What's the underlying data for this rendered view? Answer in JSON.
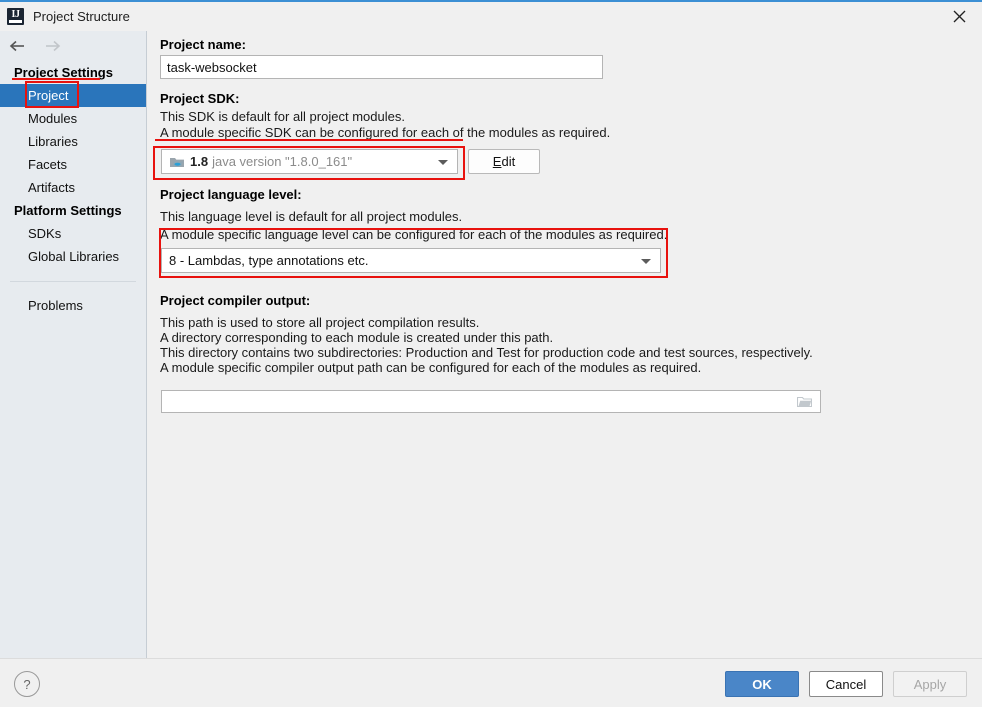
{
  "window": {
    "title": "Project Structure",
    "app_icon": "intellij-idea-icon",
    "close_icon": "close-icon"
  },
  "nav": {
    "back_icon": "arrow-left-icon",
    "forward_icon": "arrow-right-icon"
  },
  "sidebar": {
    "groups": [
      {
        "header": "Project Settings",
        "items": [
          {
            "label": "Project",
            "selected": true
          },
          {
            "label": "Modules",
            "selected": false
          },
          {
            "label": "Libraries",
            "selected": false
          },
          {
            "label": "Facets",
            "selected": false
          },
          {
            "label": "Artifacts",
            "selected": false
          }
        ]
      },
      {
        "header": "Platform Settings",
        "items": [
          {
            "label": "SDKs",
            "selected": false
          },
          {
            "label": "Global Libraries",
            "selected": false
          }
        ]
      }
    ],
    "problems_label": "Problems"
  },
  "main": {
    "project_name": {
      "label": "Project name:",
      "value": "task-websocket"
    },
    "project_sdk": {
      "label": "Project SDK:",
      "desc_1": "This SDK is default for all project modules.",
      "desc_2": "A module specific SDK can be configured for each of the modules as required.",
      "selected_version": "1.8",
      "selected_detail": "java version \"1.8.0_161\"",
      "sdk_icon": "java-sdk-icon",
      "caret_icon": "chevron-down-icon",
      "edit_button": "Edit",
      "edit_mnemonic": "E",
      "edit_rest": "dit"
    },
    "language_level": {
      "label": "Project language level:",
      "desc_1": "This language level is default for all project modules.",
      "desc_2": "A module specific language level can be configured for each of the modules as required.",
      "selected": "8 - Lambdas, type annotations etc.",
      "caret_icon": "chevron-down-icon"
    },
    "compiler_output": {
      "label": "Project compiler output:",
      "desc_1": "This path is used to store all project compilation results.",
      "desc_2": "A directory corresponding to each module is created under this path.",
      "desc_3": "This directory contains two subdirectories: Production and Test for production code and test sources, respectively.",
      "desc_4": "A module specific compiler output path can be configured for each of the modules as required.",
      "value": "",
      "browse_icon": "folder-icon"
    }
  },
  "footer": {
    "help_label": "?",
    "ok_label": "OK",
    "cancel_label": "Cancel",
    "apply_label": "Apply"
  },
  "annotations": {
    "accent_color": "#e8120e",
    "marks": [
      {
        "name": "highlight-box-project-nav",
        "type": "box"
      },
      {
        "name": "strike-project-settings",
        "type": "line"
      },
      {
        "name": "strike-module-specific-sdk",
        "type": "line"
      },
      {
        "name": "highlight-box-project-sdk",
        "type": "box"
      },
      {
        "name": "highlight-box-language-level",
        "type": "box"
      }
    ]
  },
  "colors": {
    "selection_blue": "#2a75bb",
    "ok_blue": "#4a86c8",
    "sidebar_bg": "#e7ebef",
    "panel_bg": "#f0f0f0"
  }
}
